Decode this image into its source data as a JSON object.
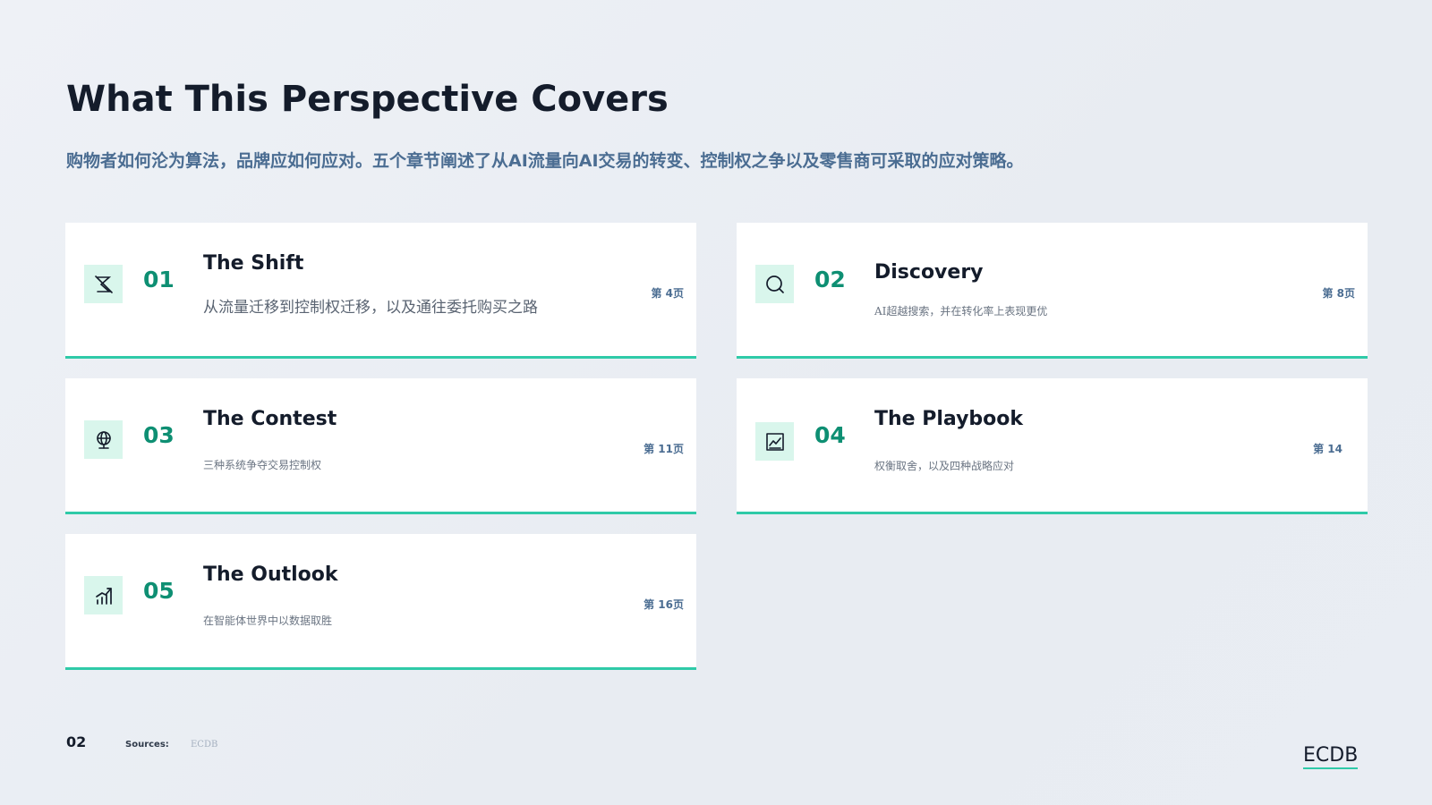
{
  "header": {
    "title": "What This Perspective Covers",
    "subtitle": "购物者如何沦为算法，品牌应如何应对。五个章节阐述了从AI流量向AI交易的转变、控制权之争以及零售商可采取的应对策略。"
  },
  "cards": [
    {
      "number": "01",
      "title": "The Shift",
      "description": "从流量迁移到控制权迁移，以及通往委托购买之路",
      "page": "第  4页",
      "icon": "no-signal-icon"
    },
    {
      "number": "02",
      "title": "Discovery",
      "description": "AI超越搜索，并在转化率上表现更优",
      "page": "第  8页",
      "icon": "search-icon"
    },
    {
      "number": "03",
      "title": "The Contest",
      "description": "三种系统争夺交易控制权",
      "page": "第  11页",
      "icon": "globe-icon"
    },
    {
      "number": "04",
      "title": "The Playbook",
      "description": "权衡取舍，以及四种战略应对",
      "page": "第  14",
      "icon": "chart-box-icon"
    },
    {
      "number": "05",
      "title": "The Outlook",
      "description": "在智能体世界中以数据取胜",
      "page": "第  16页",
      "icon": "growth-chart-icon"
    }
  ],
  "footer": {
    "page_number": "02",
    "sources_label": "Sources:",
    "sources_value": "ECDB",
    "logo": "ECDB"
  },
  "colors": {
    "accent": "#2fcaa8",
    "number": "#0e8f73",
    "subtitle": "#4b6d92",
    "icon_bg": "#d9f6ec"
  }
}
